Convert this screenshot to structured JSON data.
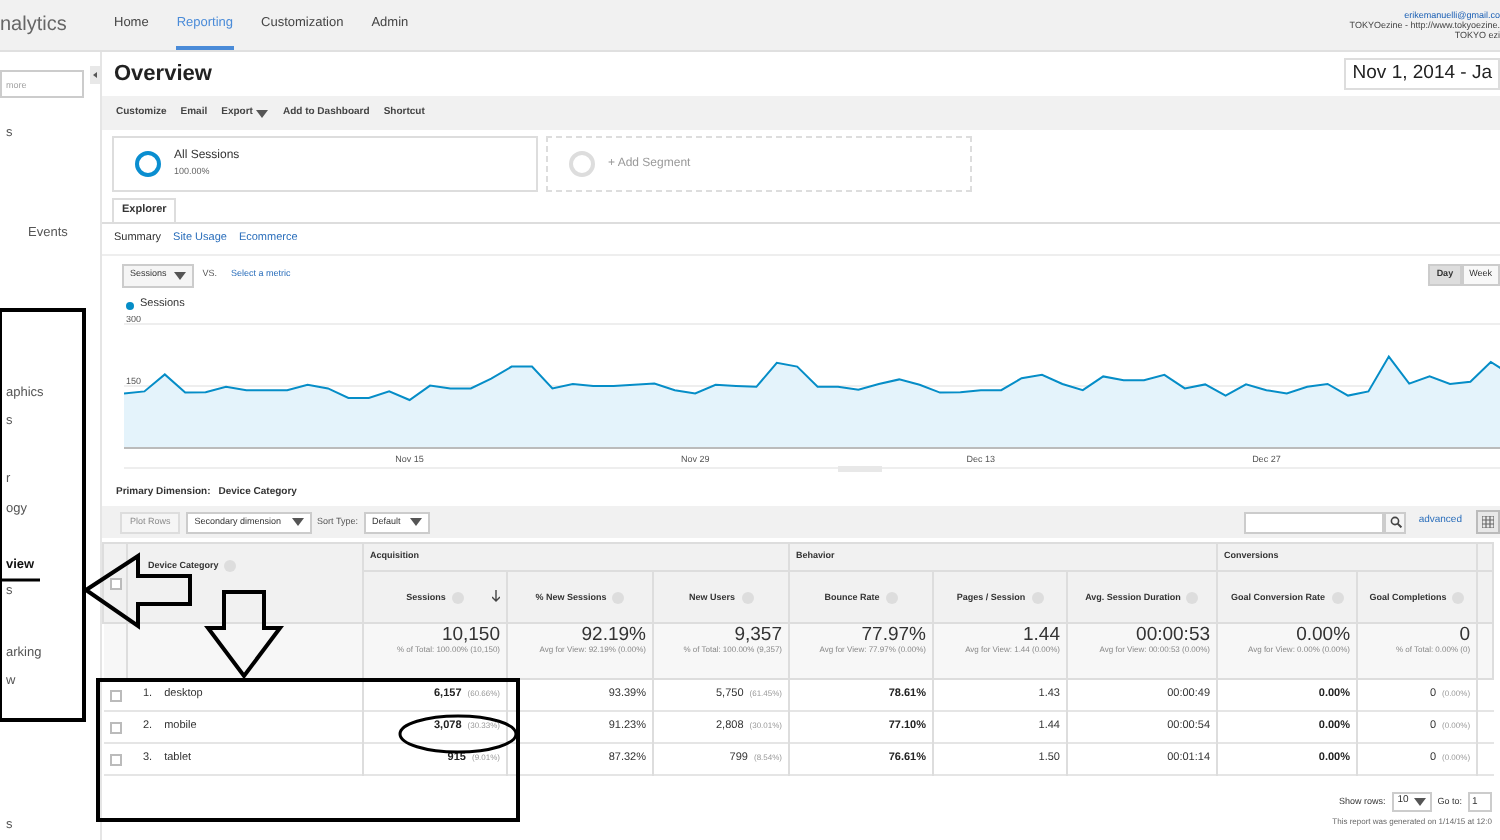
{
  "top_nav": {
    "logo": "nalytics",
    "items": [
      {
        "label": "Home",
        "selected": false
      },
      {
        "label": "Reporting",
        "selected": true
      },
      {
        "label": "Customization",
        "selected": false
      },
      {
        "label": "Admin",
        "selected": false
      }
    ],
    "account": {
      "email": "erikemanuelli@gmail.co",
      "property": "TOKYOezine - http://www.tokyoezine.",
      "view": "TOKYO ezi"
    }
  },
  "sidebar": {
    "search": {
      "placeholder": "more"
    },
    "items": [
      {
        "label": "s",
        "selected": false
      },
      {
        "label": "Events",
        "selected": false
      },
      {
        "label": "aphics",
        "selected": false
      },
      {
        "label": "s",
        "selected": false
      },
      {
        "label": "r",
        "selected": false
      },
      {
        "label": "ogy",
        "selected": false
      },
      {
        "label": "view",
        "selected": true
      },
      {
        "label": "s",
        "selected": false
      },
      {
        "label": "arking",
        "selected": false
      },
      {
        "label": "w",
        "selected": false
      },
      {
        "label": "s",
        "selected": false
      }
    ]
  },
  "header": {
    "title": "Overview",
    "date_range": "Nov 1, 2014 - Ja"
  },
  "toolbar": [
    {
      "label": "Customize",
      "kind": "plain"
    },
    {
      "label": "Email",
      "kind": "plain"
    },
    {
      "label": "Export",
      "kind": "menu"
    },
    {
      "label": "Add to Dashboard",
      "kind": "plain"
    },
    {
      "label": "Shortcut",
      "kind": "plain"
    }
  ],
  "segments": [
    {
      "kind": "segment",
      "name": "All Sessions",
      "share": "100.00%"
    },
    {
      "kind": "add",
      "name": "+ Add Segment"
    }
  ],
  "tabs": [
    {
      "label": "Explorer",
      "selected": true
    }
  ],
  "subtabs": [
    {
      "label": "Summary",
      "selected": true
    },
    {
      "label": "Site Usage",
      "selected": false
    },
    {
      "label": "Ecommerce",
      "selected": false
    }
  ],
  "metric_bar": {
    "metric": "Sessions",
    "vs": "VS.",
    "compare_link": "Select a metric",
    "intervals": [
      {
        "label": "Day",
        "selected": true
      },
      {
        "label": "Week",
        "selected": false
      }
    ]
  },
  "chart": {
    "chart_data": {
      "type": "area",
      "categories": [
        null,
        null,
        null,
        null,
        null,
        null,
        null,
        null,
        null,
        null,
        null,
        null,
        null,
        null,
        "Nov 15",
        null,
        null,
        null,
        null,
        null,
        null,
        null,
        null,
        null,
        null,
        null,
        null,
        null,
        "Nov 29",
        null,
        null,
        null,
        null,
        null,
        null,
        null,
        null,
        null,
        null,
        null,
        null,
        null,
        "Dec 13",
        null,
        null,
        null,
        null,
        null,
        null,
        null,
        null,
        null,
        null,
        null,
        null,
        null,
        "Dec 27",
        null,
        null,
        null,
        null,
        null,
        null,
        null,
        null,
        null,
        null,
        null,
        null
      ],
      "series": [
        {
          "name": "Sessions",
          "color": "#058dc7",
          "values": [
            132,
            137,
            178,
            134,
            135,
            148,
            140,
            140,
            140,
            153,
            144,
            121,
            121,
            137,
            116,
            151,
            144,
            144,
            168,
            197,
            197,
            144,
            155,
            150,
            150,
            153,
            156,
            140,
            132,
            153,
            150,
            148,
            206,
            197,
            148,
            148,
            141,
            155,
            166,
            153,
            134,
            135,
            140,
            140,
            169,
            177,
            155,
            140,
            173,
            164,
            164,
            177,
            144,
            154,
            127,
            154,
            140,
            132,
            148,
            155,
            127,
            137,
            221,
            156,
            173,
            155,
            160,
            208,
            177
          ]
        }
      ],
      "ylim": [
        0,
        300
      ],
      "yticks": [
        150,
        300
      ]
    }
  },
  "primary_dimension": {
    "label": "Primary Dimension:",
    "value": "Device Category"
  },
  "table_toolbar": {
    "plot_rows": {
      "label": "Plot Rows",
      "disabled": true
    },
    "secondary": "Secondary dimension",
    "sort_label": "Sort Type:",
    "sort_value": "Default",
    "advanced": "advanced"
  },
  "table": {
    "select_all": {
      "checked": false
    },
    "groups": [
      {
        "label": "Acquisition"
      },
      {
        "label": "Behavior"
      },
      {
        "label": "Conversions"
      }
    ],
    "dimension": {
      "label": "Device Category"
    },
    "columns": [
      {
        "label": "Sessions",
        "sorted": true
      },
      {
        "label": "% New Sessions",
        "sorted": false
      },
      {
        "label": "New Users",
        "sorted": false
      },
      {
        "label": "Bounce Rate",
        "sorted": false
      },
      {
        "label": "Pages / Session",
        "sorted": false
      },
      {
        "label": "Avg. Session Duration",
        "sorted": false
      },
      {
        "label": "Goal Conversion Rate",
        "sorted": false
      },
      {
        "label": "Goal Completions",
        "sorted": false
      }
    ],
    "totals": [
      {
        "value": "10,150",
        "note": "% of Total: 100.00% (10,150)"
      },
      {
        "value": "92.19%",
        "note": "Avg for View: 92.19% (0.00%)"
      },
      {
        "value": "9,357",
        "note": "% of Total: 100.00% (9,357)"
      },
      {
        "value": "77.97%",
        "note": "Avg for View: 77.97% (0.00%)"
      },
      {
        "value": "1.44",
        "note": "Avg for View: 1.44 (0.00%)"
      },
      {
        "value": "00:00:53",
        "note": "Avg for View: 00:00:53 (0.00%)"
      },
      {
        "value": "0.00%",
        "note": "Avg for View: 0.00% (0.00%)"
      },
      {
        "value": "0",
        "note": "% of Total: 0.00% (0)"
      }
    ],
    "rows": [
      {
        "index": "1.",
        "name": "desktop",
        "checked": false,
        "cells": [
          {
            "value": "6,157",
            "share": "(60.66%)"
          },
          {
            "value": "93.39%"
          },
          {
            "value": "5,750",
            "share": "(61.45%)"
          },
          {
            "value": "78.61%"
          },
          {
            "value": "1.43"
          },
          {
            "value": "00:00:49"
          },
          {
            "value": "0.00%"
          },
          {
            "value": "0",
            "share": "(0.00%)"
          }
        ]
      },
      {
        "index": "2.",
        "name": "mobile",
        "checked": false,
        "cells": [
          {
            "value": "3,078",
            "share": "(30.33%)"
          },
          {
            "value": "91.23%"
          },
          {
            "value": "2,808",
            "share": "(30.01%)"
          },
          {
            "value": "77.10%"
          },
          {
            "value": "1.44"
          },
          {
            "value": "00:00:54"
          },
          {
            "value": "0.00%"
          },
          {
            "value": "0",
            "share": "(0.00%)"
          }
        ]
      },
      {
        "index": "3.",
        "name": "tablet",
        "checked": false,
        "cells": [
          {
            "value": "915",
            "share": "(9.01%)"
          },
          {
            "value": "87.32%"
          },
          {
            "value": "799",
            "share": "(8.54%)"
          },
          {
            "value": "76.61%"
          },
          {
            "value": "1.50"
          },
          {
            "value": "00:01:14"
          },
          {
            "value": "0.00%"
          },
          {
            "value": "0",
            "share": "(0.00%)"
          }
        ]
      }
    ]
  },
  "footer": {
    "show_rows_label": "Show rows:",
    "show_rows_value": "10",
    "goto_label": "Go to:",
    "goto_value": "1",
    "generated": "This report was generated on 1/14/15 at 12:0"
  }
}
